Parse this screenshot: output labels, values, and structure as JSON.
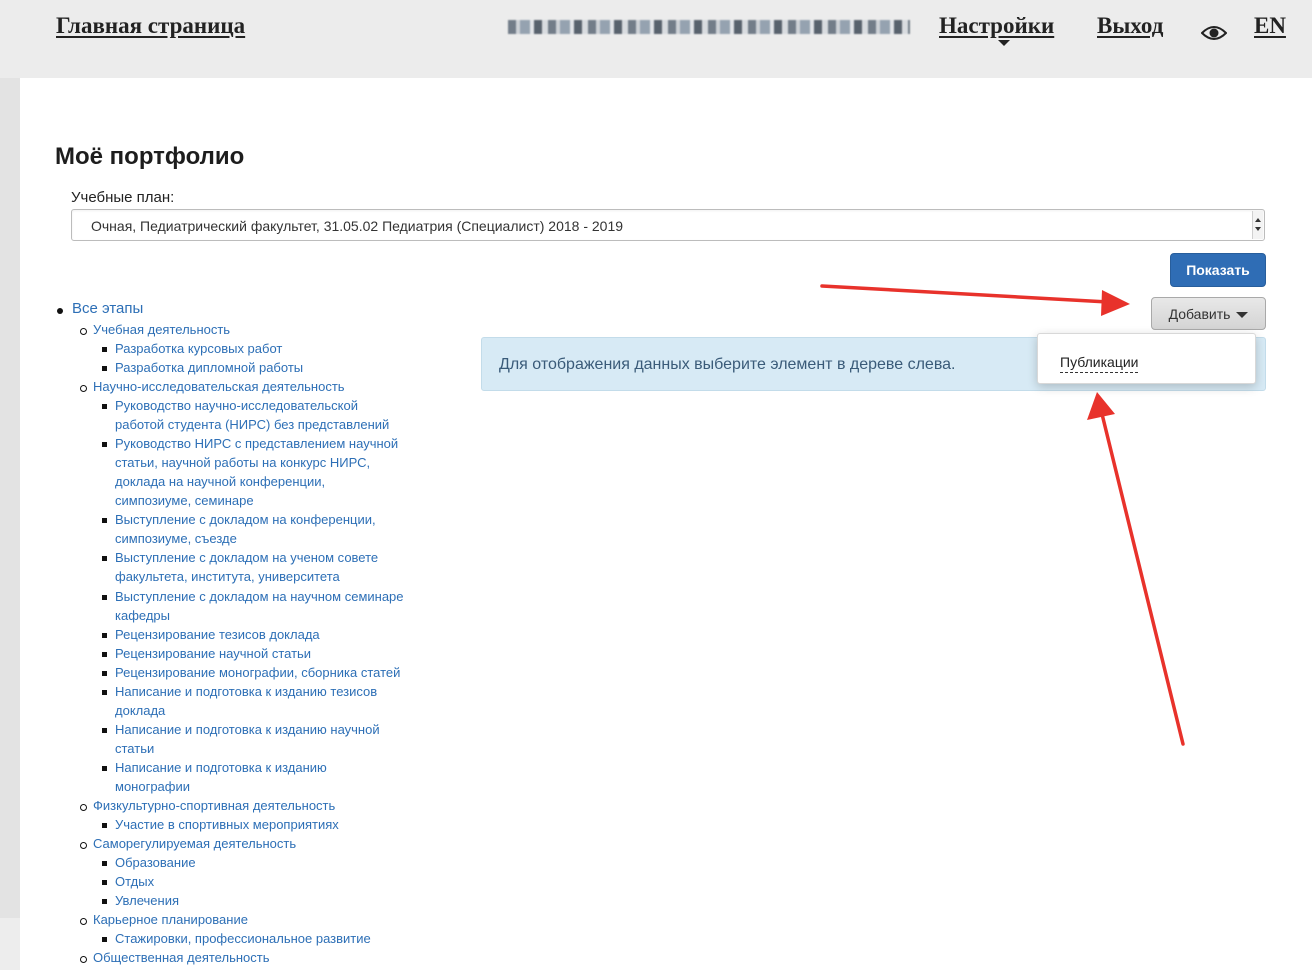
{
  "header": {
    "home_link": "Главная страница",
    "settings_link": "Настройки",
    "logout_link": "Выход",
    "lang_link": "EN",
    "eye_icon": "eye-icon"
  },
  "page": {
    "title": "Моё портфолио",
    "plan_label": "Учебные план:",
    "plan_value": "Очная, Педиатрический факультет, 31.05.02 Педиатрия (Специалист) 2018 - 2019",
    "show_button": "Показать",
    "add_button": "Добавить",
    "info_message": "Для отображения данных выберите элемент в дереве слева.",
    "dropdown_items": [
      "Публикации"
    ]
  },
  "tree": [
    "Все этапы",
    "Учебная деятельность",
    "Разработка курсовых работ",
    "Разработка дипломной работы",
    "Научно-исследовательская деятельность",
    "Руководство научно-исследовательской",
    "работой студента (НИРС) без представлений",
    "Руководство НИРС с представлением научной",
    "статьи, научной работы на конкурс НИРС,",
    "доклада на научной конференции,",
    "симпозиуме, семинаре",
    "Выступление с докладом на конференции,",
    "симпозиуме, съезде",
    "Выступление с докладом на ученом совете",
    "факультета, института, университета",
    "Выступление с докладом на научном семинаре",
    "кафедры",
    "Рецензирование тезисов доклада",
    "Рецензирование научной статьи",
    "Рецензирование монографии, сборника статей",
    "Написание и подготовка к изданию тезисов",
    "доклада",
    "Написание и подготовка к изданию научной",
    "статьи",
    "Написание и подготовка к изданию",
    "монографии",
    "Физкультурно-спортивная деятельность",
    "Участие в спортивных мероприятиях",
    "Саморегулируемая деятельность",
    "Образование",
    "Отдых",
    "Увлечения",
    "Карьерное планирование",
    "Стажировки, профессиональное развитие",
    "Общественная деятельность"
  ],
  "colors": {
    "link": "#2d6fb6",
    "primary_button": "#2f6db5",
    "info_bg": "#d7eaf5",
    "arrow": "#e8322b"
  }
}
